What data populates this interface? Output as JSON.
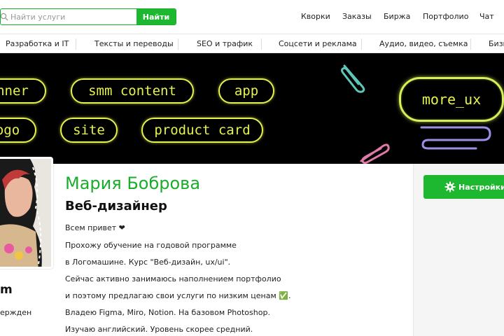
{
  "search": {
    "placeholder": "Найти услуги",
    "button_label": "Найти"
  },
  "top_nav": {
    "items": [
      "Кворки",
      "Заказы",
      "Биржа",
      "Портфолио",
      "Чат"
    ]
  },
  "categories": {
    "items": [
      "Разработка и IT",
      "Тексты и переводы",
      "SEO и трафик",
      "Соцсети и реклама",
      "Аудио, видео, съемка",
      "Бизн"
    ]
  },
  "banner": {
    "pills": [
      "nner",
      "smm content",
      "app",
      "ogo",
      "site",
      "product card"
    ],
    "big_pill": "more_ux"
  },
  "profile": {
    "name": "Мария Боброва",
    "role": "Веб-дизайнер",
    "bio": [
      "Всем привет ❤",
      "Прохожу обучение на годовой программе",
      "в Логомашине. Курс \"Веб-дизайн, ux/ui\".",
      "Сейчас активно занимаюсь наполнением портфолио",
      "и поэтому предлагаю свои услуги по низким ценам ✅.",
      "Владею Figma, Miro, Notion. На базовом Photoshop.",
      "Изучаю английский. Уровень скорее средний."
    ],
    "side_label": "m",
    "side_status": "ержден"
  },
  "settings": {
    "button_label": "Настройки п"
  },
  "colors": {
    "accent": "#1db82f",
    "name_green": "#1aad2b",
    "neon": "#e6f24f",
    "banner_bg": "#000000"
  }
}
